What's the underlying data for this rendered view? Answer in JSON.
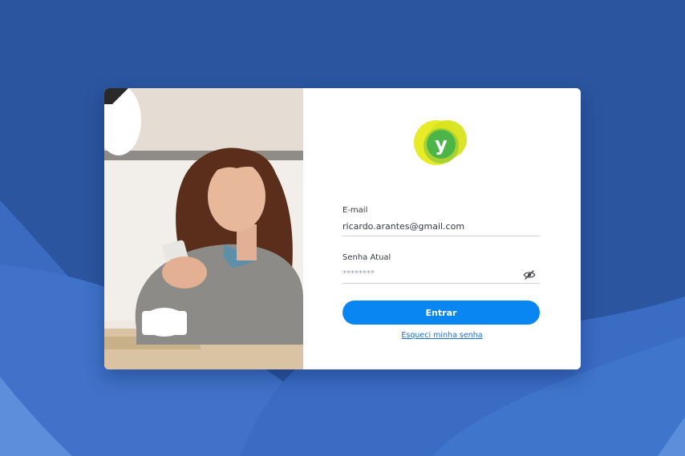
{
  "login": {
    "email_label": "E-mail",
    "email_value": "ricardo.arantes@gmail.com",
    "password_label": "Senha Atual",
    "password_value": "********",
    "submit_label": "Entrar",
    "forgot_label": "Esqueci minha senha"
  },
  "logo": {
    "letter": "y"
  },
  "icons": {
    "password_toggle": "eye-off-icon"
  },
  "colors": {
    "background": "#2b559f",
    "accent": "#0a86f2",
    "link": "#1f6fd1",
    "logo_yellow": "#e6ea1c",
    "logo_green": "#4cb548"
  }
}
